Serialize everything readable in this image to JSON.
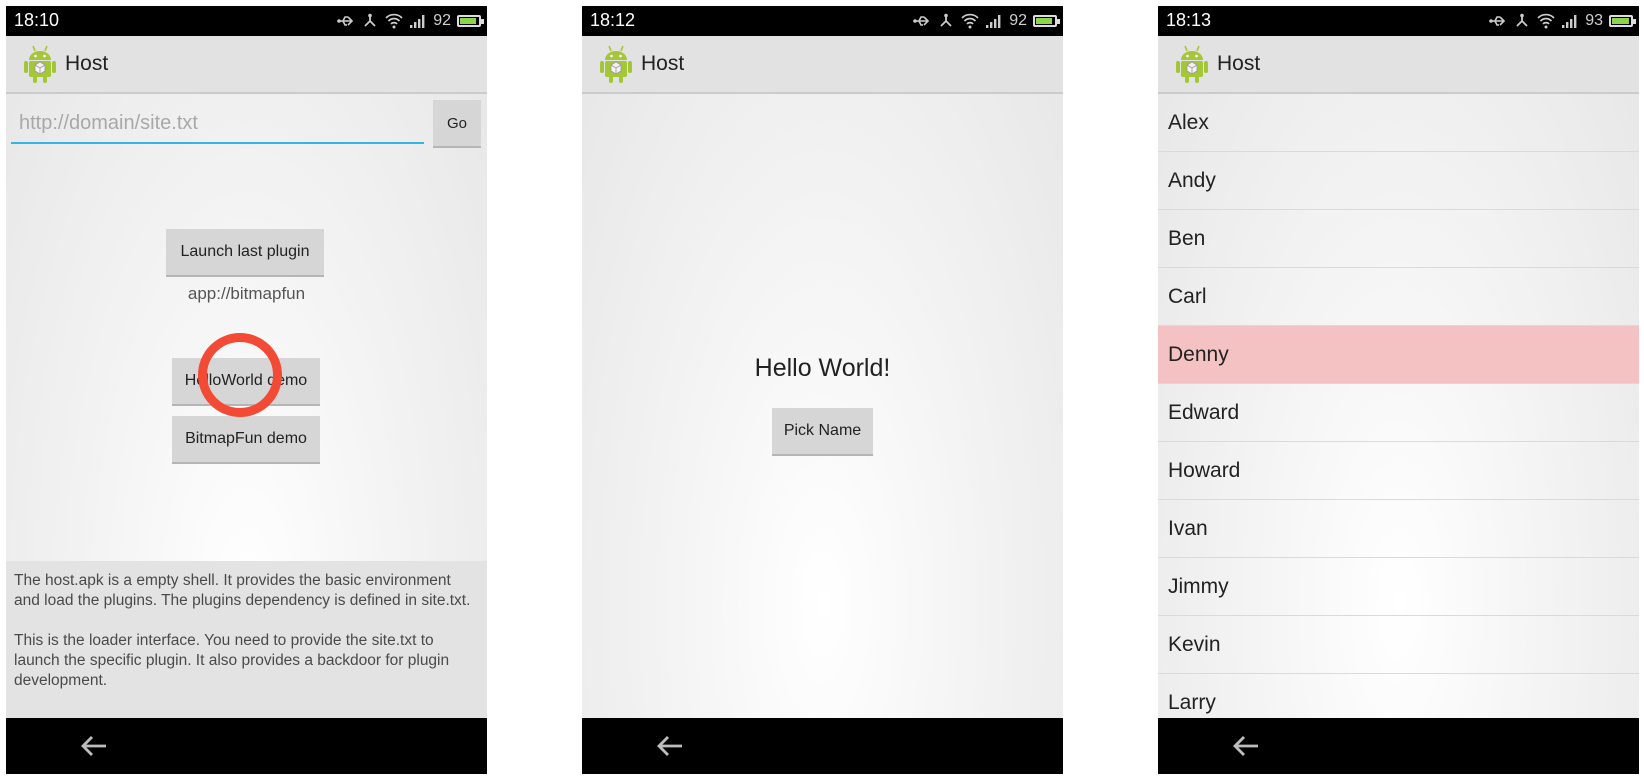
{
  "screens": [
    {
      "status": {
        "time": "18:10",
        "battery_pct": "92",
        "battery_level": 0.92
      },
      "action_bar": {
        "title": "Host",
        "icon": "android-robot-icon"
      },
      "url_input": {
        "placeholder": "http://domain/site.txt",
        "value": ""
      },
      "go_label": "Go",
      "launch_last_label": "Launch last plugin",
      "last_plugin_url": "app://bitmapfun",
      "hello_demo_label": "HelloWorld demo",
      "bitmap_demo_label": "BitmapFun demo",
      "info": {
        "para1": "The host.apk is a empty shell. It provides the basic environment and load the plugins. The plugins dependency is defined in site.txt.",
        "para2": "This is the loader interface. You need to provide the site.txt to launch the specific plugin. It also provides a backdoor for plugin development."
      },
      "tap_highlight_color": "#f24a35"
    },
    {
      "status": {
        "time": "18:12",
        "battery_pct": "92",
        "battery_level": 0.92
      },
      "action_bar": {
        "title": "Host",
        "icon": "android-robot-icon"
      },
      "hello_text": "Hello World!",
      "pick_name_label": "Pick Name"
    },
    {
      "status": {
        "time": "18:13",
        "battery_pct": "93",
        "battery_level": 0.93
      },
      "action_bar": {
        "title": "Host",
        "icon": "android-robot-icon"
      },
      "names": [
        "Alex",
        "Andy",
        "Ben",
        "Carl",
        "Denny",
        "Edward",
        "Howard",
        "Ivan",
        "Jimmy",
        "Kevin",
        "Larry"
      ],
      "selected_name": "Denny",
      "selected_color": "#f4c2c2"
    }
  ],
  "status_icons": [
    "usb-icon",
    "debug-icon",
    "wifi-icon",
    "signal-icon",
    "battery-icon"
  ],
  "nav": {
    "back_icon": "back-arrow-icon"
  },
  "colors": {
    "accent": "#33b5e5",
    "battery_fill": "#8bd648",
    "status_bar": "#000000",
    "action_bar": "#e2e2e2"
  }
}
